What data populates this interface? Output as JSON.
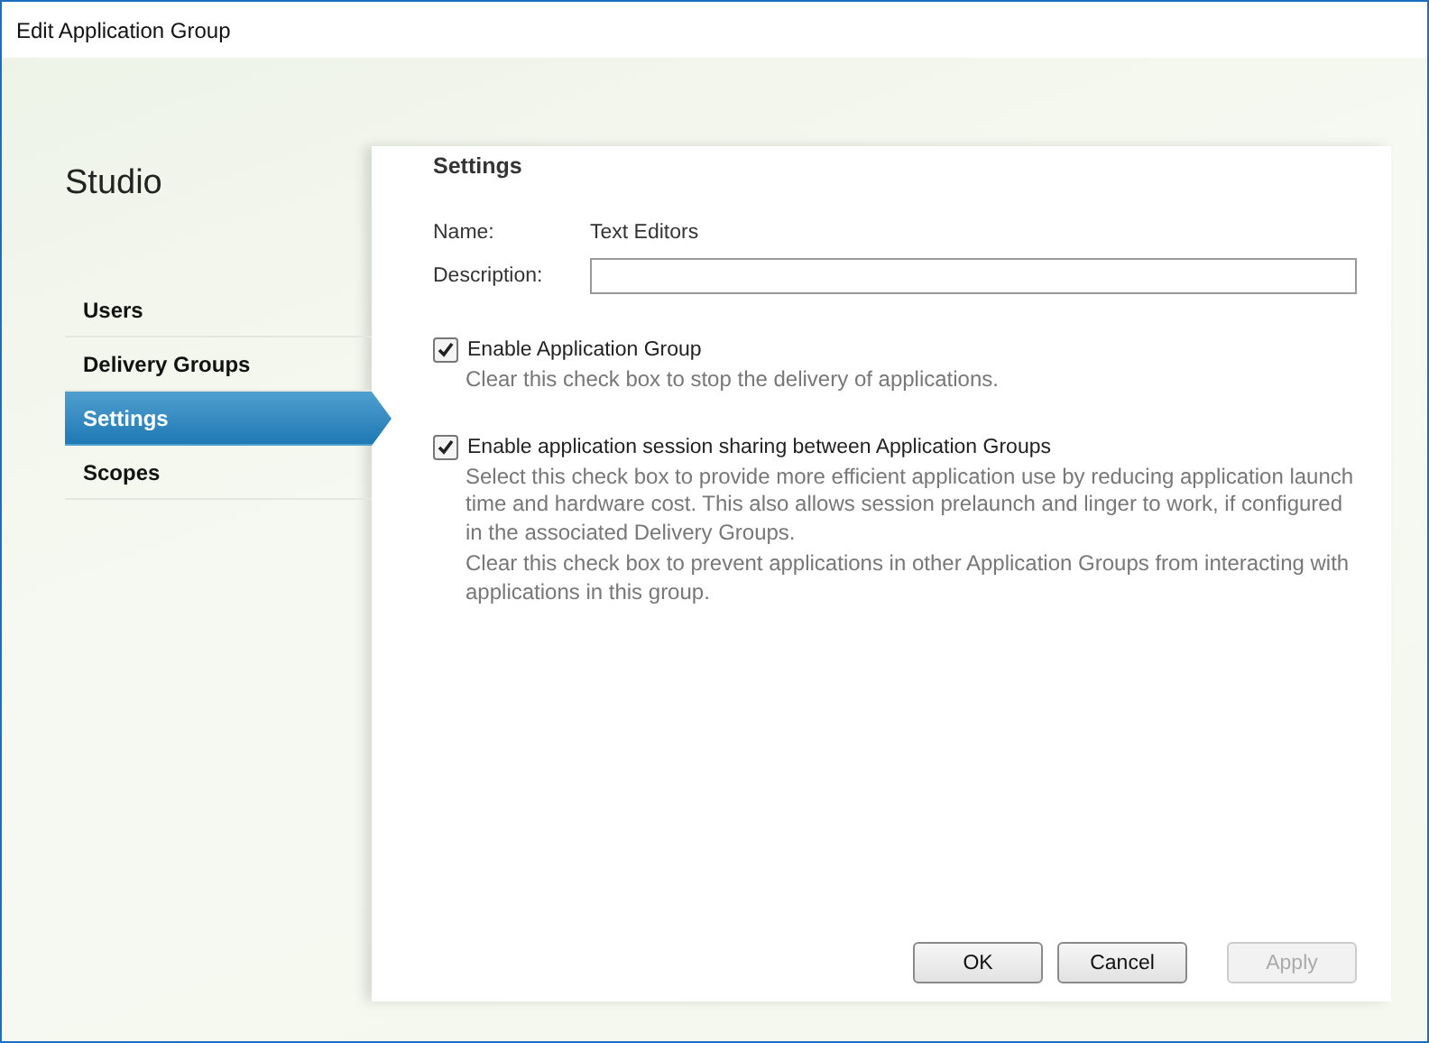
{
  "window": {
    "title": "Edit Application Group"
  },
  "sidebar": {
    "title": "Studio",
    "items": [
      {
        "label": "Users",
        "selected": false
      },
      {
        "label": "Delivery Groups",
        "selected": false
      },
      {
        "label": "Settings",
        "selected": true
      },
      {
        "label": "Scopes",
        "selected": false
      }
    ]
  },
  "content": {
    "heading": "Settings",
    "name": {
      "label": "Name:",
      "value": "Text Editors"
    },
    "description": {
      "label": "Description:"
    },
    "options": [
      {
        "label": "Enable Application Group",
        "checked": true,
        "help": [
          "Clear this check box to stop the delivery of applications."
        ]
      },
      {
        "label": "Enable application session sharing between Application Groups",
        "checked": true,
        "help": [
          "Select this check box to provide more efficient application use by reducing application launch time and hardware cost. This also allows session prelaunch and linger to work, if configured in the associated Delivery Groups.",
          "Clear this check box to prevent applications in other Application Groups from interacting with applications in this group."
        ]
      }
    ]
  },
  "buttons": [
    {
      "label": "OK",
      "disabled": false
    },
    {
      "label": "Cancel",
      "disabled": false
    },
    {
      "label": "Apply",
      "disabled": true
    }
  ]
}
